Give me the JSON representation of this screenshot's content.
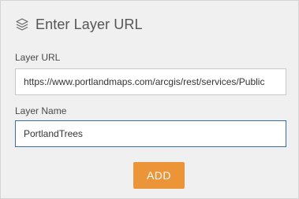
{
  "header": {
    "title": "Enter Layer URL",
    "icon": "layers-icon"
  },
  "fields": {
    "url": {
      "label": "Layer URL",
      "value": "https://www.portlandmaps.com/arcgis/rest/services/Public"
    },
    "name": {
      "label": "Layer Name",
      "value": "PortlandTrees"
    }
  },
  "actions": {
    "add_label": "ADD"
  },
  "colors": {
    "panel_bg": "#f0f0f0",
    "accent": "#ec9438",
    "focus_border": "#3a6fa3"
  }
}
